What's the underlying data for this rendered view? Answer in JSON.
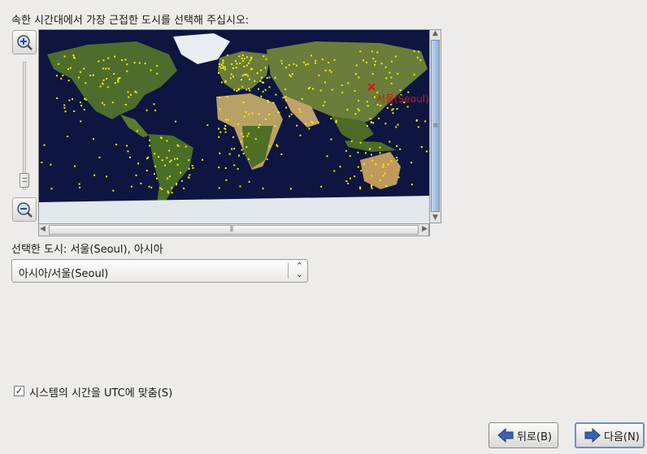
{
  "prompt": "속한 시간대에서 가장 근접한 도시를 선택해 주십시오:",
  "map": {
    "selected_city_marker": "서울(Seoul)",
    "marker_color": "#e01010",
    "ocean_color": "#0d1540",
    "city_dot_color": "#f2f200"
  },
  "selected_label": "선택한 도시: 서울(Seoul), 아시아",
  "timezone_select": {
    "value": "아시아/서울(Seoul)"
  },
  "utc_checkbox": {
    "checked": true,
    "check_glyph": "✓",
    "label": "시스템의 시간을 UTC에 맞춤(S)"
  },
  "buttons": {
    "back": "뒤로(B)",
    "next": "다음(N)"
  },
  "icons": {
    "zoom_in": "zoom-in-icon",
    "zoom_out": "zoom-out-icon",
    "back": "arrow-left-icon",
    "next": "arrow-right-icon"
  }
}
